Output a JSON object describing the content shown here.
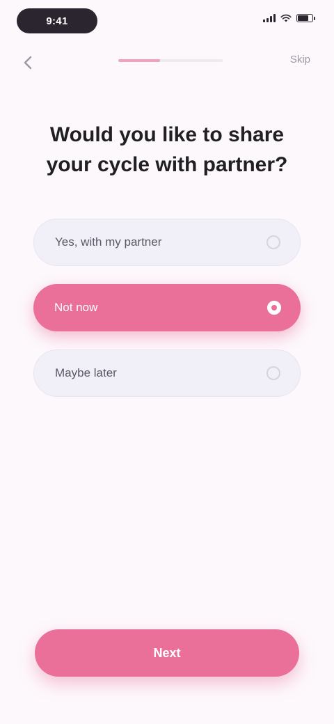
{
  "status_bar": {
    "time": "9:41",
    "icons": [
      "signal-icon",
      "wifi-icon",
      "battery-icon"
    ]
  },
  "top_nav": {
    "back_icon": "chevron-left-icon",
    "progress_fraction": 0.4,
    "skip_label": "Skip"
  },
  "question": {
    "title": "Would you like to share your cycle with partner?"
  },
  "options": [
    {
      "label": "Yes, with my partner",
      "selected": false
    },
    {
      "label": "Not now",
      "selected": true
    },
    {
      "label": "Maybe later",
      "selected": false
    }
  ],
  "footer": {
    "continue_label": "Next"
  },
  "colors": {
    "accent": "#ea6f99",
    "background": "#fdf8fc",
    "option_bg": "#f1eff8",
    "text": "#1f1f24"
  }
}
